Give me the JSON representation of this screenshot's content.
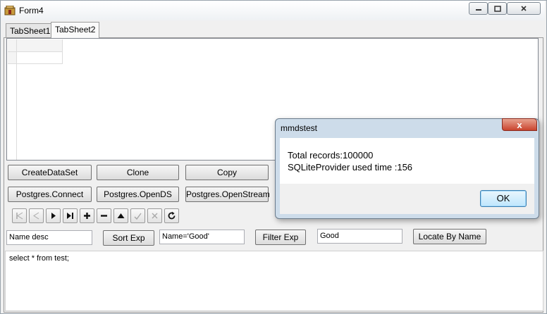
{
  "window": {
    "title": "Form4",
    "controls": [
      "minimize",
      "maximize",
      "close"
    ]
  },
  "tabs": [
    {
      "label": "TabSheet1"
    },
    {
      "label": "TabSheet2"
    }
  ],
  "buttons": {
    "create_dataset": "CreateDataSet",
    "clone": "Clone",
    "copy": "Copy",
    "pg_connect": "Postgres.Connect",
    "pg_opends": "Postgres.OpenDS",
    "pg_openstream": "Postgres.OpenStream",
    "sort_exp": "Sort Exp",
    "filter_exp": "Filter Exp",
    "locate_by_name": "Locate By Name"
  },
  "navigator": [
    "first",
    "prior",
    "next",
    "last",
    "insert",
    "delete",
    "edit",
    "post",
    "cancel",
    "refresh"
  ],
  "fields": {
    "sort_value": "Name desc",
    "filter_value": "Name='Good'",
    "locate_value": "Good"
  },
  "memo": {
    "text": "select * from test;"
  },
  "dialog": {
    "title": "mmdstest",
    "line1": "Total records:100000",
    "line2": "SQLiteProvider used time :156",
    "ok_label": "OK",
    "close_glyph": "x"
  }
}
